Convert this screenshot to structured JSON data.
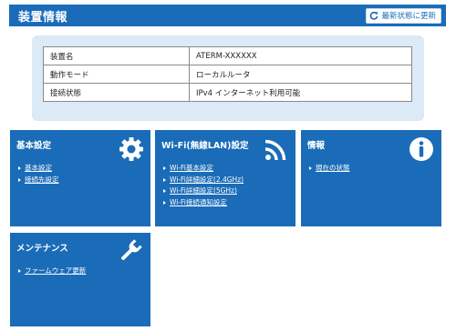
{
  "header": {
    "title": "装置情報",
    "refresh_label": "最新状態に更新"
  },
  "device_info": [
    {
      "label": "装置名",
      "value": "ATERM-XXXXXX"
    },
    {
      "label": "動作モード",
      "value": "ローカルルータ"
    },
    {
      "label": "接続状態",
      "value": "IPv4 インターネット利用可能"
    }
  ],
  "cards": {
    "basic": {
      "title": "基本設定",
      "icon": "gear-icon",
      "links": [
        "基本設定",
        "接続先設定"
      ]
    },
    "wifi": {
      "title": "Wi-Fi(無線LAN)設定",
      "icon": "wifi-signal-icon",
      "links": [
        "Wi-Fi基本設定",
        "Wi-Fi詳細設定(2.4GHz)",
        "Wi-Fi詳細設定(5GHz)",
        "Wi-Fi接続通知設定"
      ]
    },
    "info": {
      "title": "情報",
      "icon": "info-icon",
      "links": [
        "現在の状態"
      ]
    },
    "maintenance": {
      "title": "メンテナンス",
      "icon": "wrench-icon",
      "links": [
        "ファームウェア更新"
      ]
    }
  },
  "colors": {
    "primary": "#1b6cb8",
    "panel_background": "#dce9f6"
  }
}
